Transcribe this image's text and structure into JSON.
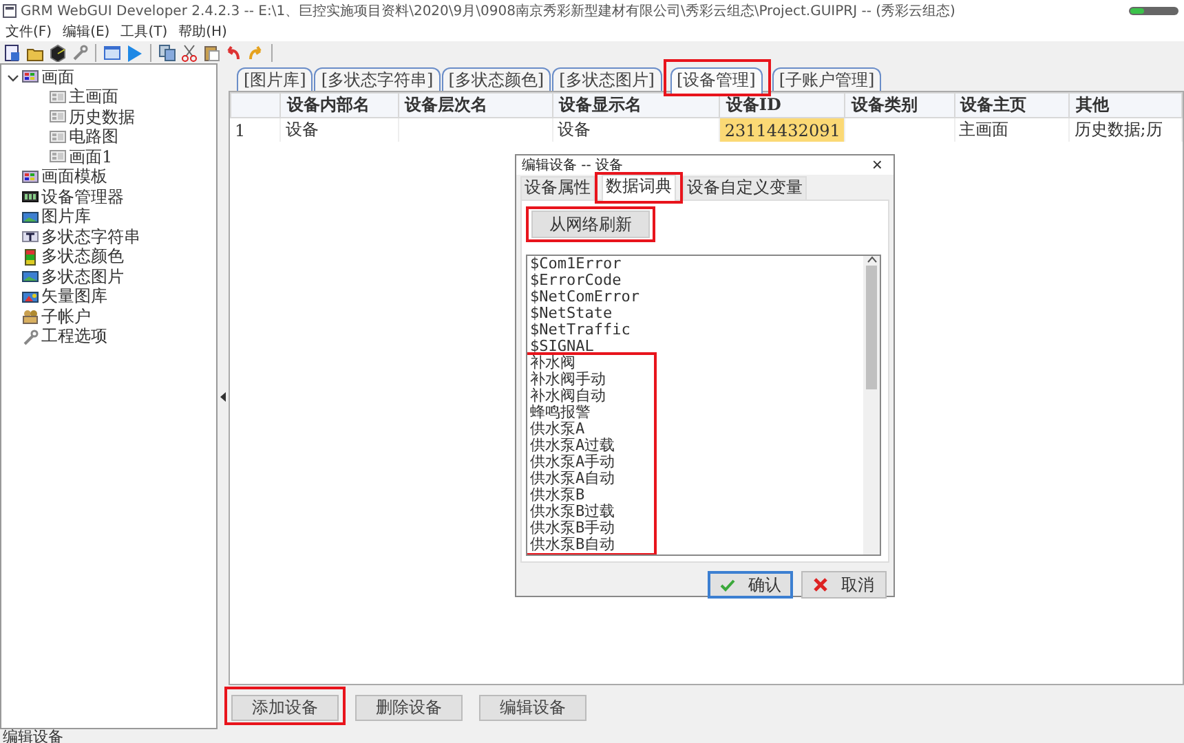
{
  "window": {
    "title": "GRM WebGUI Developer 2.4.2.3 -- E:\\1、巨控实施项目资料\\2020\\9月\\0908南京秀彩新型建材有限公司\\秀彩云组态\\Project.GUIPRJ -- (秀彩云组态)"
  },
  "menu": [
    "文件(F)",
    "编辑(E)",
    "工具(T)",
    "帮助(H)"
  ],
  "tree": [
    {
      "label": "画面",
      "kind": "group",
      "expanded": true,
      "children": [
        {
          "label": "主画面",
          "kind": "screen"
        },
        {
          "label": "历史数据",
          "kind": "screen"
        },
        {
          "label": "电路图",
          "kind": "screen"
        },
        {
          "label": "画面1",
          "kind": "screen"
        }
      ]
    },
    {
      "label": "画面模板",
      "kind": "group"
    },
    {
      "label": "设备管理器",
      "kind": "device"
    },
    {
      "label": "图片库",
      "kind": "image"
    },
    {
      "label": "多状态字符串",
      "kind": "text"
    },
    {
      "label": "多状态颜色",
      "kind": "color"
    },
    {
      "label": "多状态图片",
      "kind": "image"
    },
    {
      "label": "矢量图库",
      "kind": "vector"
    },
    {
      "label": "子帐户",
      "kind": "account"
    },
    {
      "label": "工程选项",
      "kind": "wrench"
    }
  ],
  "tabs": [
    {
      "label": "[图片库]",
      "selected": false,
      "highlighted": false
    },
    {
      "label": "[多状态字符串]",
      "selected": false,
      "highlighted": false
    },
    {
      "label": "[多状态颜色]",
      "selected": false,
      "highlighted": false
    },
    {
      "label": "[多状态图片]",
      "selected": false,
      "highlighted": false
    },
    {
      "label": "[设备管理]",
      "selected": true,
      "highlighted": true
    },
    {
      "label": "[子账户管理]",
      "selected": false,
      "highlighted": false
    }
  ],
  "table": {
    "columns": [
      "设备内部名",
      "设备层次名",
      "设备显示名",
      "设备ID",
      "设备类别",
      "设备主页",
      "其他"
    ],
    "rows": [
      {
        "number": "1",
        "cells": [
          {
            "text": "设备",
            "selected": false
          },
          {
            "selected": false
          },
          {
            "text": "设备",
            "selected": false
          },
          {
            "text": "23114432091",
            "selected": true
          },
          {
            "selected": false
          },
          {
            "text": "主画面",
            "selected": false
          },
          {
            "text": "历史数据;历",
            "selected": false
          }
        ]
      }
    ]
  },
  "buttons": [
    {
      "label": "添加设备",
      "highlighted": true
    },
    {
      "label": "删除设备",
      "highlighted": false
    },
    {
      "label": "编辑设备",
      "highlighted": false
    }
  ],
  "status_bar": {
    "text": "编辑设备"
  },
  "dialog": {
    "title": "编辑设备 -- 设备",
    "close": "×",
    "tabs": [
      {
        "label": "设备属性",
        "selected": false,
        "highlighted": false
      },
      {
        "label": "数据词典",
        "selected": true,
        "highlighted": true
      },
      {
        "label": "设备自定义变量",
        "selected": false,
        "highlighted": false
      }
    ],
    "refresh_button": {
      "label": "从网络刷新",
      "highlighted": true
    },
    "items": [
      {
        "text": "$Com1Error",
        "highlighted": false
      },
      {
        "text": "$ErrorCode",
        "highlighted": false
      },
      {
        "text": "$NetComError",
        "highlighted": false
      },
      {
        "text": "$NetState",
        "highlighted": false
      },
      {
        "text": "$NetTraffic",
        "highlighted": false
      },
      {
        "text": "$SIGNAL",
        "highlighted": false
      },
      {
        "text": "补水阀",
        "highlighted": true
      },
      {
        "text": "补水阀手动",
        "highlighted": true
      },
      {
        "text": "补水阀自动",
        "highlighted": true
      },
      {
        "text": "蜂鸣报警",
        "highlighted": true
      },
      {
        "text": "供水泵A",
        "highlighted": true
      },
      {
        "text": "供水泵A过载",
        "highlighted": true
      },
      {
        "text": "供水泵A手动",
        "highlighted": true
      },
      {
        "text": "供水泵A自动",
        "highlighted": true
      },
      {
        "text": "供水泵B",
        "highlighted": true
      },
      {
        "text": "供水泵B过载",
        "highlighted": true
      },
      {
        "text": "供水泵B手动",
        "highlighted": true
      },
      {
        "text": "供水泵B自动",
        "highlighted": true
      }
    ],
    "buttons": [
      {
        "label": "确认",
        "kind": "ok",
        "focused": true
      },
      {
        "label": "取消",
        "kind": "cancel",
        "focused": false
      }
    ]
  }
}
